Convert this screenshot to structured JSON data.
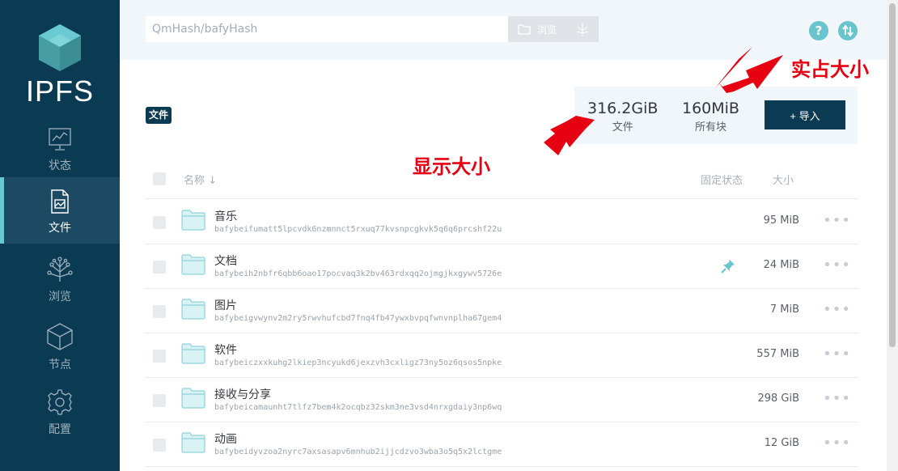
{
  "app": {
    "logo_text": "IPFS"
  },
  "sidebar": {
    "items": [
      {
        "label": "状态",
        "icon": "status-chart-icon",
        "active": false
      },
      {
        "label": "文件",
        "icon": "files-document-icon",
        "active": true
      },
      {
        "label": "浏览",
        "icon": "explore-tree-icon",
        "active": false
      },
      {
        "label": "节点",
        "icon": "peers-cube-icon",
        "active": false
      },
      {
        "label": "配置",
        "icon": "settings-gear-icon",
        "active": false
      }
    ]
  },
  "header": {
    "search_placeholder": "QmHash/bafyHash",
    "browse_label": "浏览",
    "help_icon": "help-icon",
    "sync_icon": "sync-arrows-icon"
  },
  "files": {
    "tag": "文件",
    "stats": {
      "files_size": "316.2GiB",
      "files_label": "文件",
      "blocks_size": "160MiB",
      "blocks_label": "所有块"
    },
    "import_label": "+ 导入",
    "columns": {
      "name": "名称 ↓",
      "pin_status": "固定状态",
      "size": "大小"
    },
    "rows": [
      {
        "name": "音乐",
        "cid": "bafybeifumatt5lpcvdk6nzmnnct5rxuq77kvsnpcgkvk5q6q6prcshf22u",
        "size": "95 MiB",
        "pinned": false
      },
      {
        "name": "文档",
        "cid": "bafybeih2nbfr6qbb6oao17pocvaq3k2bv463rdxqq2ojmgjkxgywv5726e",
        "size": "24 MiB",
        "pinned": true
      },
      {
        "name": "图片",
        "cid": "bafybeigvwynv2m2ry5rwvhufcbd7fnq4fb47ywxbvpqfwnvnplha67gem4",
        "size": "7 MiB",
        "pinned": false
      },
      {
        "name": "软件",
        "cid": "bafybeiczxxkuhg2lkiep3ncyukd6jexzvh3cxligz73ny5oz6qsos5npke",
        "size": "557 MiB",
        "pinned": false
      },
      {
        "name": "接收与分享",
        "cid": "bafybeicamaunht7tlfz7bem4k2ocqbz32skm3ne3vsd4nrxgdaiy3np6wq",
        "size": "298 GiB",
        "pinned": false
      },
      {
        "name": "动画",
        "cid": "bafybeidyvzoa2nyrc7axsasapv6mnhub2ijjcdzvo3wba3o5q5x2lctgme",
        "size": "12 GiB",
        "pinned": false
      }
    ]
  },
  "annotations": {
    "actual_size": "实占大小",
    "display_size": "显示大小",
    "color": "#e60012"
  },
  "colors": {
    "sidebar_bg": "#0b3a53",
    "accent": "#69c4cd",
    "header_bg": "#f0f6fa"
  }
}
